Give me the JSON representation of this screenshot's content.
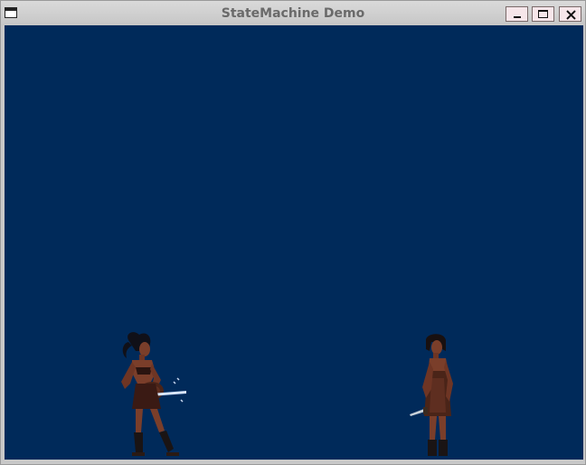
{
  "window": {
    "title": "StateMachine Demo",
    "controls": {
      "minimize": "minimize",
      "maximize": "maximize",
      "close": "close"
    }
  },
  "scene": {
    "background_color": "#002a5a",
    "characters": [
      {
        "role": "player-warrior",
        "facing": "right",
        "weapon": "sword",
        "state": "idle"
      },
      {
        "role": "enemy-warrior",
        "facing": "left",
        "weapon": "dagger",
        "state": "idle"
      }
    ]
  }
}
